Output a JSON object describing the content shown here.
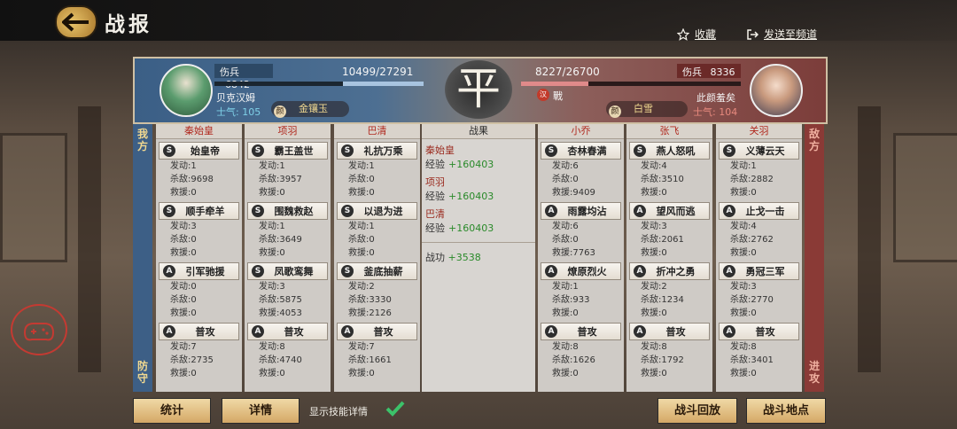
{
  "header": {
    "title": "战报",
    "favorite_label": "收藏",
    "send_label": "发送至频道"
  },
  "left_side": {
    "casualty_label": "伤兵",
    "casualty": "6842",
    "hp": "10499/27291",
    "hp_fraction": 0.385,
    "name": "贝克汉姆",
    "morale": "士气: 105",
    "beauty_icon": "颜",
    "beauty_name": "金镶玉",
    "side_top": "我方",
    "side_bottom": "防守"
  },
  "right_side": {
    "casualty_label": "伤兵",
    "casualty": "8336",
    "hp": "8227/26700",
    "hp_fraction": 0.308,
    "status_badge": "汉",
    "status": "戰",
    "name": "此颜羞矣",
    "morale": "士气: 104",
    "beauty_icon": "颜",
    "beauty_name": "白雪",
    "side_top": "敌方",
    "side_bottom": "进攻"
  },
  "result_seal": "平",
  "stat_labels": {
    "launch": "发动:",
    "kill": "杀敌:",
    "rescue": "救援:"
  },
  "columns": [
    {
      "general": "秦始皇",
      "skills": [
        {
          "grade": "S",
          "name": "始皇帝",
          "launch": "1",
          "kill": "9698",
          "rescue": "0"
        },
        {
          "grade": "S",
          "name": "顺手牵羊",
          "launch": "3",
          "kill": "0",
          "rescue": "0"
        },
        {
          "grade": "A",
          "name": "引军驰援",
          "launch": "0",
          "kill": "0",
          "rescue": "0"
        },
        {
          "grade": "A",
          "name": "普攻",
          "launch": "7",
          "kill": "2735",
          "rescue": "0"
        }
      ]
    },
    {
      "general": "项羽",
      "skills": [
        {
          "grade": "S",
          "name": "霸王盖世",
          "launch": "1",
          "kill": "3957",
          "rescue": "0"
        },
        {
          "grade": "S",
          "name": "围魏救赵",
          "launch": "1",
          "kill": "3649",
          "rescue": "0"
        },
        {
          "grade": "S",
          "name": "凤歌鸾舞",
          "launch": "3",
          "kill": "5875",
          "rescue": "4053"
        },
        {
          "grade": "A",
          "name": "普攻",
          "launch": "8",
          "kill": "4740",
          "rescue": "0"
        }
      ]
    },
    {
      "general": "巴清",
      "skills": [
        {
          "grade": "S",
          "name": "礼抗万乘",
          "launch": "1",
          "kill": "0",
          "rescue": "0"
        },
        {
          "grade": "S",
          "name": "以退为进",
          "launch": "1",
          "kill": "0",
          "rescue": "0"
        },
        {
          "grade": "S",
          "name": "釜底抽薪",
          "launch": "2",
          "kill": "3330",
          "rescue": "2126"
        },
        {
          "grade": "A",
          "name": "普攻",
          "launch": "7",
          "kill": "1661",
          "rescue": "0"
        }
      ]
    },
    {
      "general": "小乔",
      "skills": [
        {
          "grade": "S",
          "name": "杏林春满",
          "launch": "6",
          "kill": "0",
          "rescue": "9409"
        },
        {
          "grade": "A",
          "name": "雨露均沾",
          "launch": "6",
          "kill": "0",
          "rescue": "7763"
        },
        {
          "grade": "A",
          "name": "燎原烈火",
          "launch": "1",
          "kill": "933",
          "rescue": "0"
        },
        {
          "grade": "A",
          "name": "普攻",
          "launch": "8",
          "kill": "1626",
          "rescue": "0"
        }
      ]
    },
    {
      "general": "张飞",
      "skills": [
        {
          "grade": "S",
          "name": "燕人怒吼",
          "launch": "4",
          "kill": "3510",
          "rescue": "0"
        },
        {
          "grade": "A",
          "name": "望风而逃",
          "launch": "3",
          "kill": "2061",
          "rescue": "0"
        },
        {
          "grade": "A",
          "name": "折冲之勇",
          "launch": "2",
          "kill": "1234",
          "rescue": "0"
        },
        {
          "grade": "A",
          "name": "普攻",
          "launch": "8",
          "kill": "1792",
          "rescue": "0"
        }
      ]
    },
    {
      "general": "关羽",
      "skills": [
        {
          "grade": "S",
          "name": "义薄云天",
          "launch": "1",
          "kill": "2882",
          "rescue": "0"
        },
        {
          "grade": "A",
          "name": "止戈一击",
          "launch": "4",
          "kill": "2762",
          "rescue": "0"
        },
        {
          "grade": "A",
          "name": "勇冠三军",
          "launch": "3",
          "kill": "2770",
          "rescue": "0"
        },
        {
          "grade": "A",
          "name": "普攻",
          "launch": "8",
          "kill": "3401",
          "rescue": "0"
        }
      ]
    }
  ],
  "results": {
    "header": "战果",
    "exp_label": "经验",
    "entries": [
      {
        "name": "秦始皇",
        "exp": "+160403"
      },
      {
        "name": "项羽",
        "exp": "+160403"
      },
      {
        "name": "巴清",
        "exp": "+160403"
      }
    ],
    "merit_label": "战功",
    "merit": "+3538"
  },
  "footer": {
    "stats_button": "统计",
    "details_button": "详情",
    "show_skill_details": "显示技能详情",
    "show_skill_details_checked": true,
    "replay_button": "战斗回放",
    "location_button": "战斗地点"
  },
  "colors": {
    "ally_blue": "#3d5f86",
    "enemy_red": "#8a3a36",
    "accent_gold": "#e8c46a",
    "exp_green": "#2a8a2a"
  }
}
